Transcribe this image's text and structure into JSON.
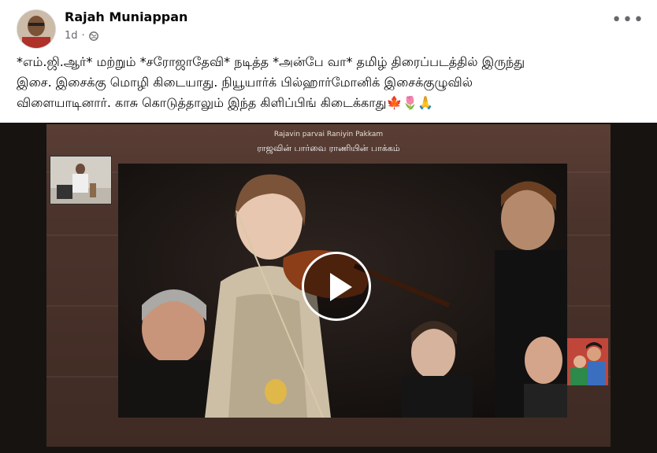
{
  "post": {
    "author": "Rajah Muniappan",
    "time": "1d",
    "text": "*எம்.ஜி.ஆர்* மற்றும் *சரோஜாதேவி* நடித்த *அன்பே வா* தமிழ் திரைப்படத்தில் இருந்து\nஇசை.  இசைக்கு மொழி கிடையாது.  நியூயார்க் பில்ஹார்மோனிக் இசைக்குழுவில்\nவிளையாடினார்.  காசு கொடுத்தாலும் இந்த கிளிப்பிங் கிடைக்காது🍁🌷🙏"
  },
  "video": {
    "title_english": "Rajavin parvai Raniyin Pakkam",
    "title_tamil": "ராஜவின் பார்வை ராணியின் பாக்கம்"
  },
  "icons": {
    "privacy": "globe-icon",
    "more": "more-options-icon",
    "play": "play-icon"
  }
}
